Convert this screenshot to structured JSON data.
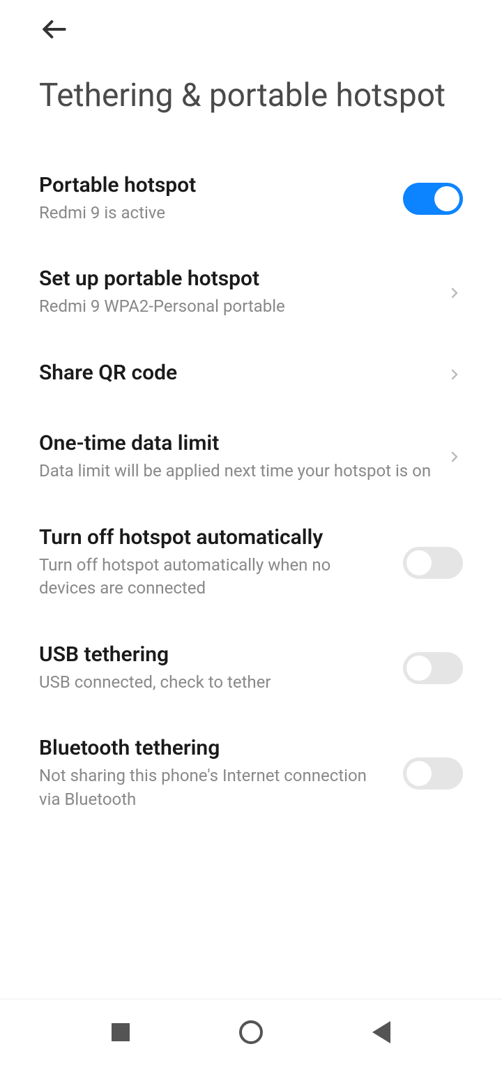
{
  "page": {
    "title": "Tethering & portable hotspot"
  },
  "settings": {
    "portable_hotspot": {
      "title": "Portable hotspot",
      "subtitle": "Redmi 9 is active",
      "enabled": true
    },
    "setup_hotspot": {
      "title": "Set up portable hotspot",
      "subtitle": "Redmi 9 WPA2-Personal portable"
    },
    "share_qr": {
      "title": "Share QR code"
    },
    "data_limit": {
      "title": "One-time data limit",
      "subtitle": "Data limit will be applied next time your hotspot is on"
    },
    "auto_off": {
      "title": "Turn off hotspot automatically",
      "subtitle": "Turn off hotspot automatically when no devices are connected",
      "enabled": false
    },
    "usb_tethering": {
      "title": "USB tethering",
      "subtitle": "USB connected, check to tether",
      "enabled": false
    },
    "bluetooth_tethering": {
      "title": "Bluetooth tethering",
      "subtitle": "Not sharing this phone's Internet connection via Bluetooth",
      "enabled": false
    }
  }
}
